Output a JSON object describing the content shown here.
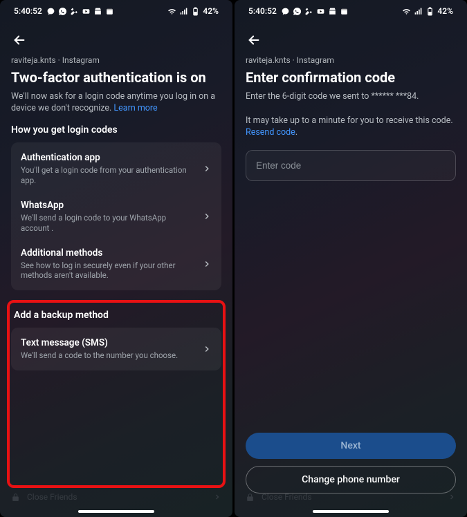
{
  "status": {
    "time": "5:40:52",
    "battery": "42%"
  },
  "left": {
    "crumb": "raviteja.knts · Instagram",
    "title": "Two-factor authentication is on",
    "subtitle_a": "We'll now ask for a login code anytime you log in on a device we don't recognize. ",
    "learn_more": "Learn more",
    "section1": "How you get login codes",
    "rows": [
      {
        "title": "Authentication app",
        "sub": "You'll get a login code from your authentication app."
      },
      {
        "title": "WhatsApp",
        "sub": "We'll send a login code to your WhatsApp account ."
      },
      {
        "title": "Additional methods",
        "sub": "See how to log in securely even if your other methods aren't available."
      }
    ],
    "section2": "Add a backup method",
    "backup": {
      "title": "Text message (SMS)",
      "sub": "We'll send a code to the number you choose."
    },
    "bg_label": "Close Friends"
  },
  "right": {
    "crumb": "raviteja.knts · Instagram",
    "title": "Enter confirmation code",
    "line1": "Enter the 6-digit code we sent to ****** ***84.",
    "line2a": "It may take up to a minute for you to receive this code. ",
    "resend": "Resend code",
    "placeholder": "Enter code",
    "btn_next": "Next",
    "btn_change": "Change phone number",
    "bg_label": "Close Friends"
  }
}
